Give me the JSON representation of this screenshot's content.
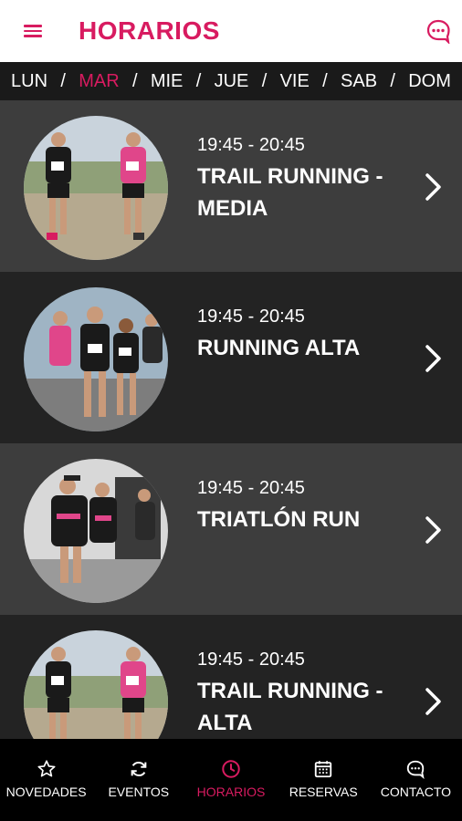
{
  "header": {
    "title": "HORARIOS",
    "accent_color": "#d81b60",
    "menu_icon": "hamburger-menu-icon",
    "chat_icon": "chat-bubble-icon"
  },
  "days": [
    {
      "label": "LUN",
      "active": false
    },
    {
      "label": "MAR",
      "active": true
    },
    {
      "label": "MIE",
      "active": false
    },
    {
      "label": "JUE",
      "active": false
    },
    {
      "label": "VIE",
      "active": false
    },
    {
      "label": "SAB",
      "active": false
    },
    {
      "label": "DOM",
      "active": false
    }
  ],
  "day_separator": "/",
  "classes": [
    {
      "time": "19:45 - 20:45",
      "name": "TRAIL RUNNING - MEDIA",
      "photo": "trail-runners-photo"
    },
    {
      "time": "19:45 - 20:45",
      "name": "RUNNING ALTA",
      "photo": "group-runners-photo"
    },
    {
      "time": "19:45 - 20:45",
      "name": "TRIATLÓN RUN",
      "photo": "triathlon-runners-photo"
    },
    {
      "time": "19:45 - 20:45",
      "name": "TRAIL RUNNING - ALTA",
      "photo": "trail-runners-photo"
    }
  ],
  "nav": [
    {
      "label": "NOVEDADES",
      "icon": "star-icon",
      "active": false
    },
    {
      "label": "EVENTOS",
      "icon": "refresh-icon",
      "active": false
    },
    {
      "label": "HORARIOS",
      "icon": "clock-icon",
      "active": true
    },
    {
      "label": "RESERVAS",
      "icon": "calendar-icon",
      "active": false
    },
    {
      "label": "CONTACTO",
      "icon": "chat-bubble-icon",
      "active": false
    }
  ]
}
